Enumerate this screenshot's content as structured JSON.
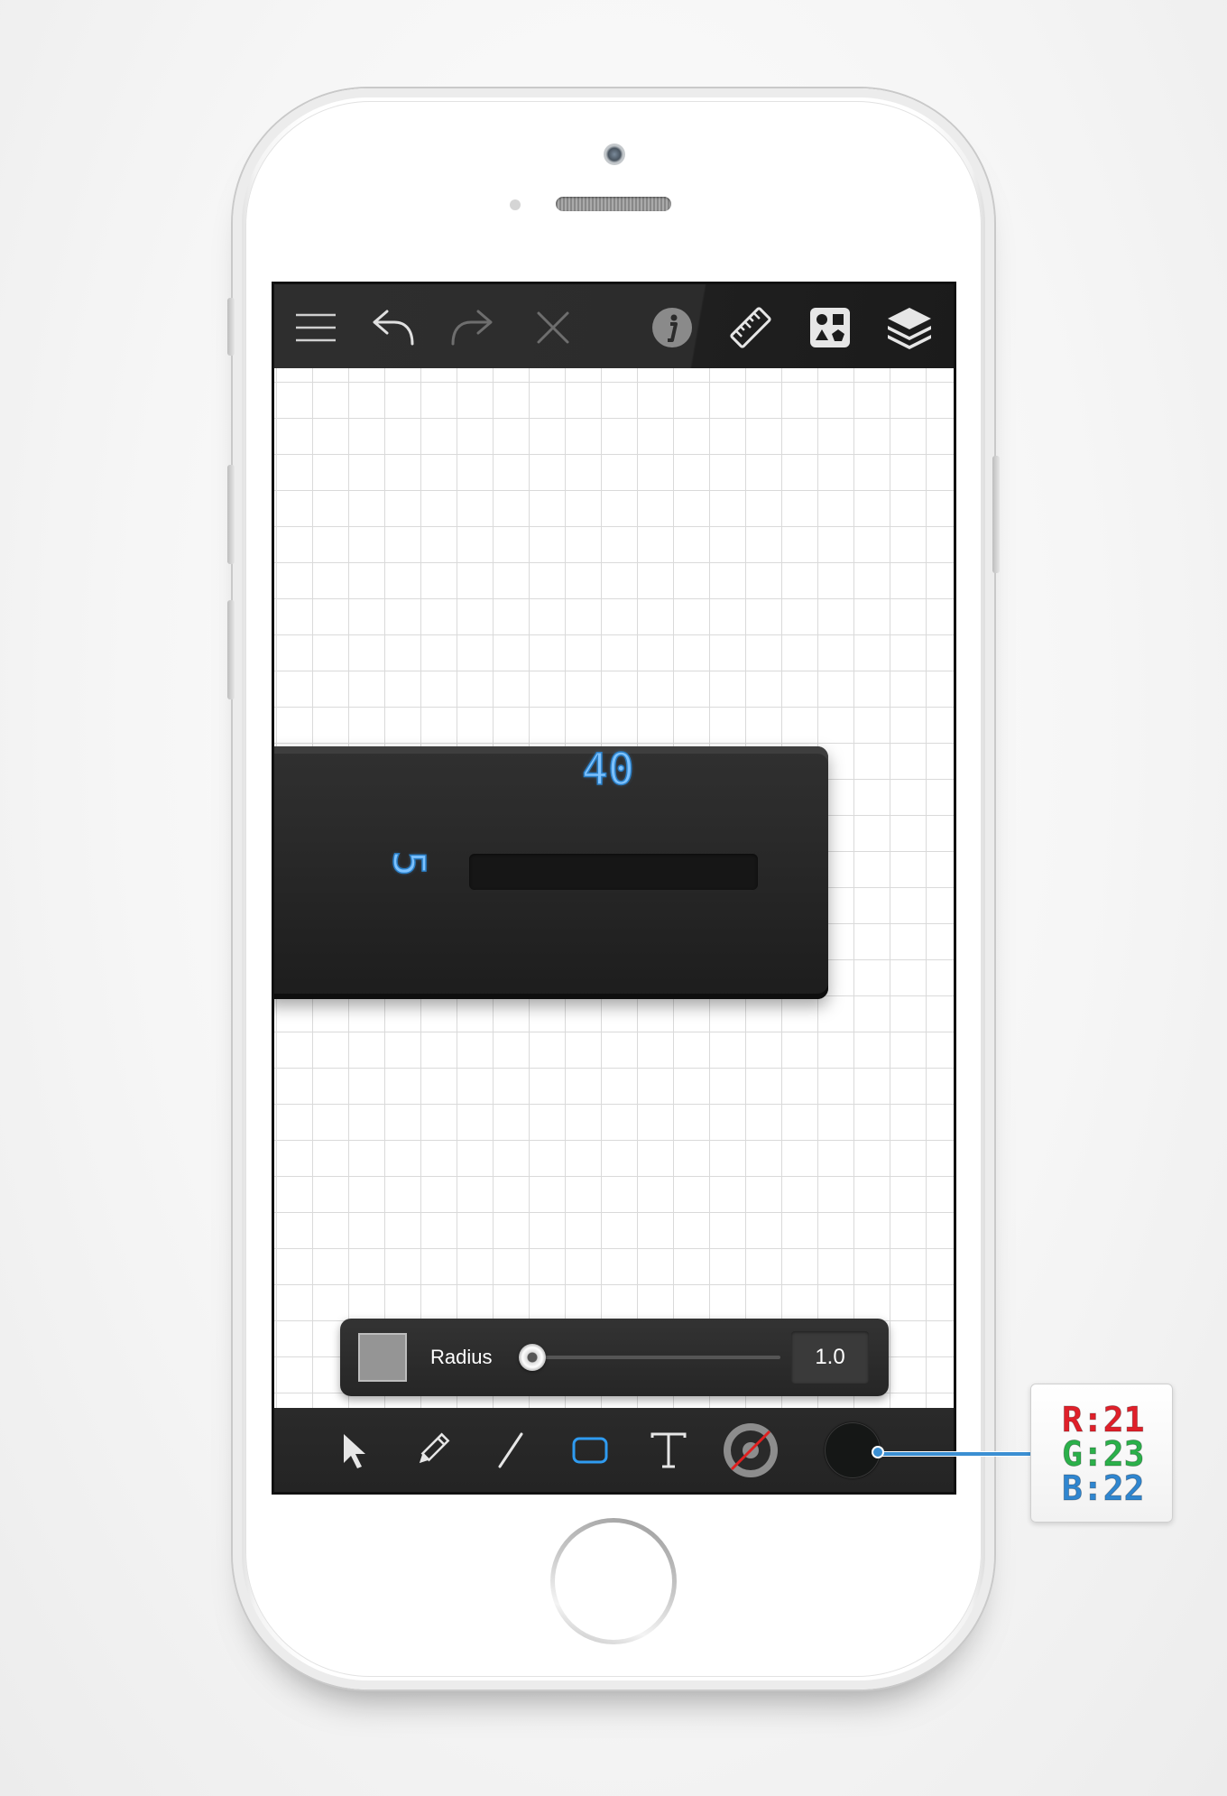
{
  "toolbar": {
    "menu_icon": "hamburger-menu-icon",
    "undo_icon": "undo-arrow-icon",
    "redo_icon": "redo-arrow-icon",
    "close_icon": "close-x-icon",
    "info_icon": "info-icon",
    "ruler_icon": "ruler-icon",
    "shapes_icon": "shapes-library-icon",
    "layers_icon": "layers-icon"
  },
  "dial": {
    "top_value": "40",
    "side_value": "5",
    "value_color": "#7dc2ff"
  },
  "radius_panel": {
    "label": "Radius",
    "value": "1.0",
    "slider_level": 0.0,
    "swatch_color": "#959595"
  },
  "tools": {
    "items": [
      "select-arrow-icon",
      "pencil-icon",
      "line-icon",
      "rectangle-icon",
      "text-icon",
      "stroke-color-icon"
    ],
    "active": "rectangle-icon",
    "accent_color": "#2f9bf0"
  },
  "fill_color": {
    "hex": "#151716",
    "r_label": "R:21",
    "g_label": "G:23",
    "b_label": "B:22",
    "r_color": "#e0202a",
    "g_color": "#2bb04a",
    "b_color": "#2f86d0"
  }
}
